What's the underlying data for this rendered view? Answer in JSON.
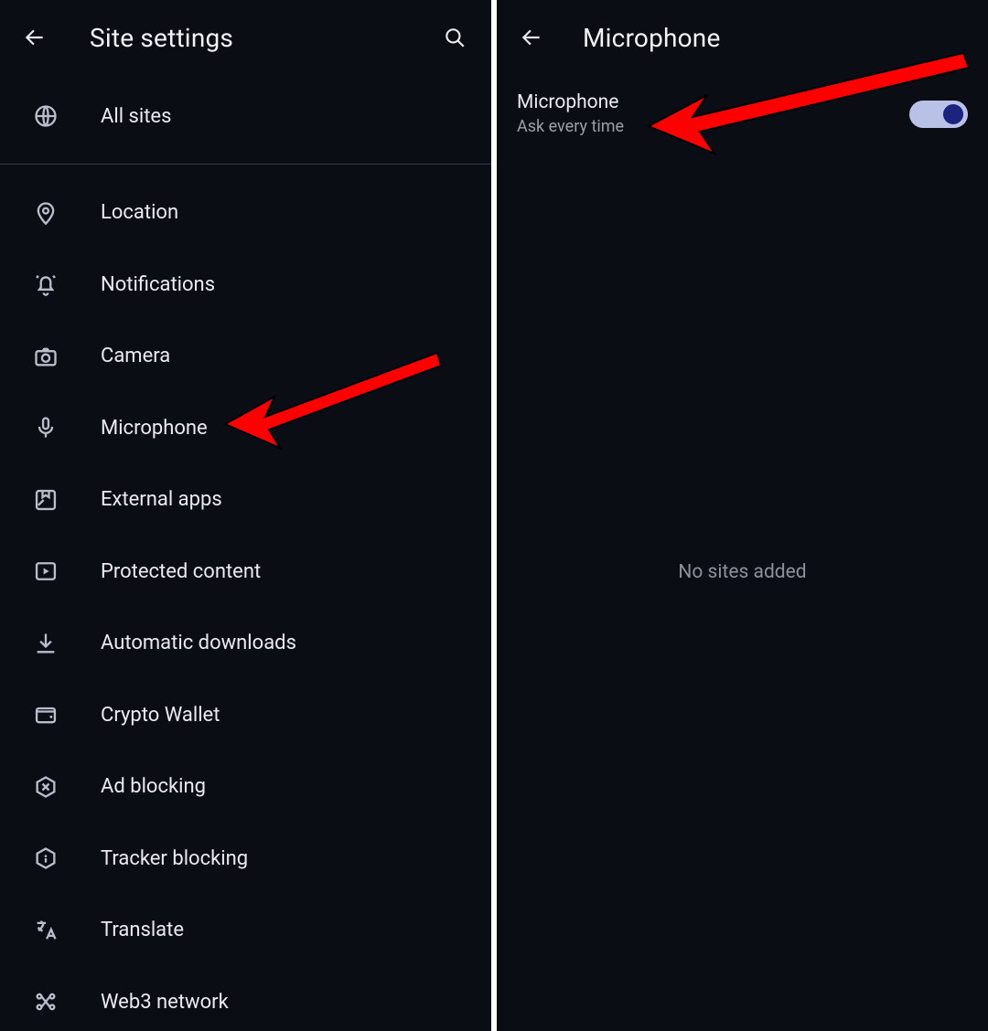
{
  "left": {
    "title": "Site settings",
    "items": [
      {
        "label": "All sites"
      },
      {
        "label": "Location"
      },
      {
        "label": "Notifications"
      },
      {
        "label": "Camera"
      },
      {
        "label": "Microphone"
      },
      {
        "label": "External apps"
      },
      {
        "label": "Protected content"
      },
      {
        "label": "Automatic downloads"
      },
      {
        "label": "Crypto Wallet"
      },
      {
        "label": "Ad blocking"
      },
      {
        "label": "Tracker blocking"
      },
      {
        "label": "Translate"
      },
      {
        "label": "Web3 network"
      }
    ]
  },
  "right": {
    "title": "Microphone",
    "toggle": {
      "primary": "Microphone",
      "secondary": "Ask every time",
      "on": true
    },
    "empty": "No sites added"
  }
}
